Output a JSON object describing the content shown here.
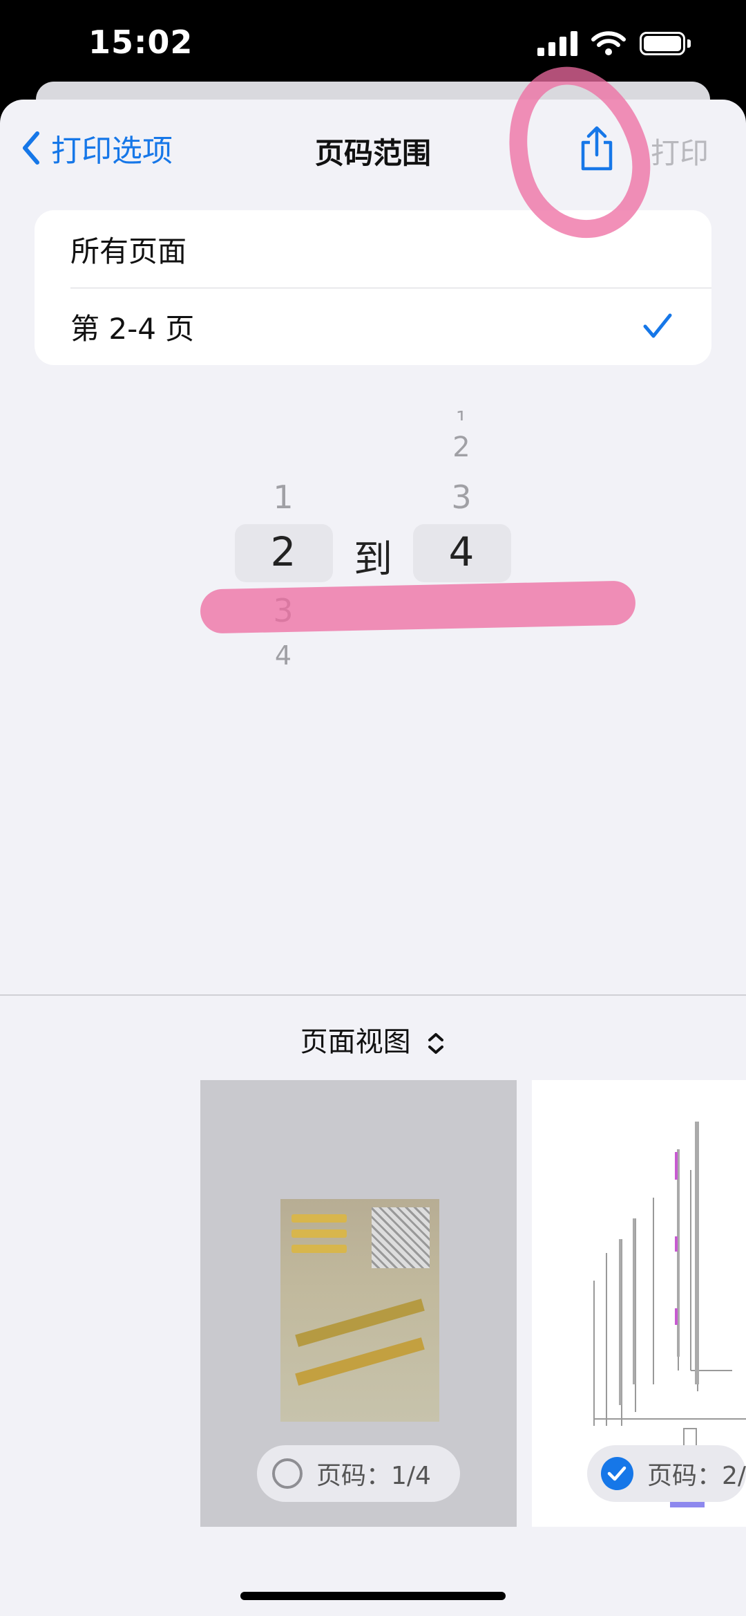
{
  "status_bar": {
    "time": "15:02"
  },
  "nav": {
    "back_label": "打印选项",
    "title": "页码范围",
    "print_label": "打印"
  },
  "options": {
    "all_pages": "所有页面",
    "range": "第 2-4 页",
    "selected": "range"
  },
  "picker": {
    "from_values": [
      "1",
      "2",
      "3",
      "4"
    ],
    "from_selected": "2",
    "separator": "到",
    "to_values": [
      "1",
      "2",
      "3",
      "4"
    ],
    "to_selected": "4"
  },
  "preview": {
    "view_toggle_label": "页面视图",
    "pages": [
      {
        "label": "页码：1/4",
        "selected": false
      },
      {
        "label": "页码：2/",
        "selected": true
      }
    ]
  },
  "colors": {
    "accent": "#1677e8",
    "background": "#f2f2f7",
    "annotation": "#ee6ba0"
  }
}
